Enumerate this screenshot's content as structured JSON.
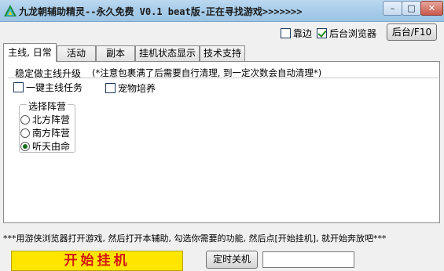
{
  "window": {
    "title": "九龙朝辅助精灵--永久免费 V0.1 beat版-正在寻找游戏>>>>>>>",
    "controls": {
      "minimize": "–",
      "maximize": "□",
      "close": "✕"
    }
  },
  "topbar": {
    "checkbox_dock": {
      "label": "靠边",
      "checked": false
    },
    "checkbox_bg_browser": {
      "label": "后台浏览器",
      "checked": true
    },
    "background_button": "后台/F10"
  },
  "tabs": [
    {
      "label": "主线, 日常",
      "active": true
    },
    {
      "label": "活动",
      "active": false
    },
    {
      "label": "副本",
      "active": false
    },
    {
      "label": "挂机状态显示",
      "active": false
    },
    {
      "label": "技术支持",
      "active": false
    }
  ],
  "main": {
    "section_title": "稳定做主线升级",
    "section_note": "(*注意包裹满了后需要自行清理, 到一定次数会自动清理*)",
    "checkbox_mainline": {
      "label": "一键主线任务",
      "checked": false
    },
    "checkbox_pet": {
      "label": "宠物培养",
      "checked": false
    },
    "faction_group": {
      "title": "选择阵营",
      "options": [
        {
          "label": "北方阵营",
          "selected": false
        },
        {
          "label": "南方阵营",
          "selected": false
        },
        {
          "label": "听天由命",
          "selected": true
        }
      ]
    }
  },
  "footer": {
    "message": "***用游侠浏览器打开游戏, 然后打开本辅助, 勾选你需要的功能, 然后点[开始挂机], 就开始奔放吧***",
    "start_button": "开始挂机",
    "timer_shutdown_button": "定时关机",
    "timer_input_value": ""
  },
  "colors": {
    "titlebar": "#a9cdea",
    "start_button_bg": "#ffe600",
    "start_button_text": "#d31616",
    "check_mark": "#1a8a1a"
  },
  "icons": {
    "app": "app-logo-icon",
    "minimize": "minimize-icon",
    "maximize": "maximize-icon",
    "close": "close-icon"
  }
}
